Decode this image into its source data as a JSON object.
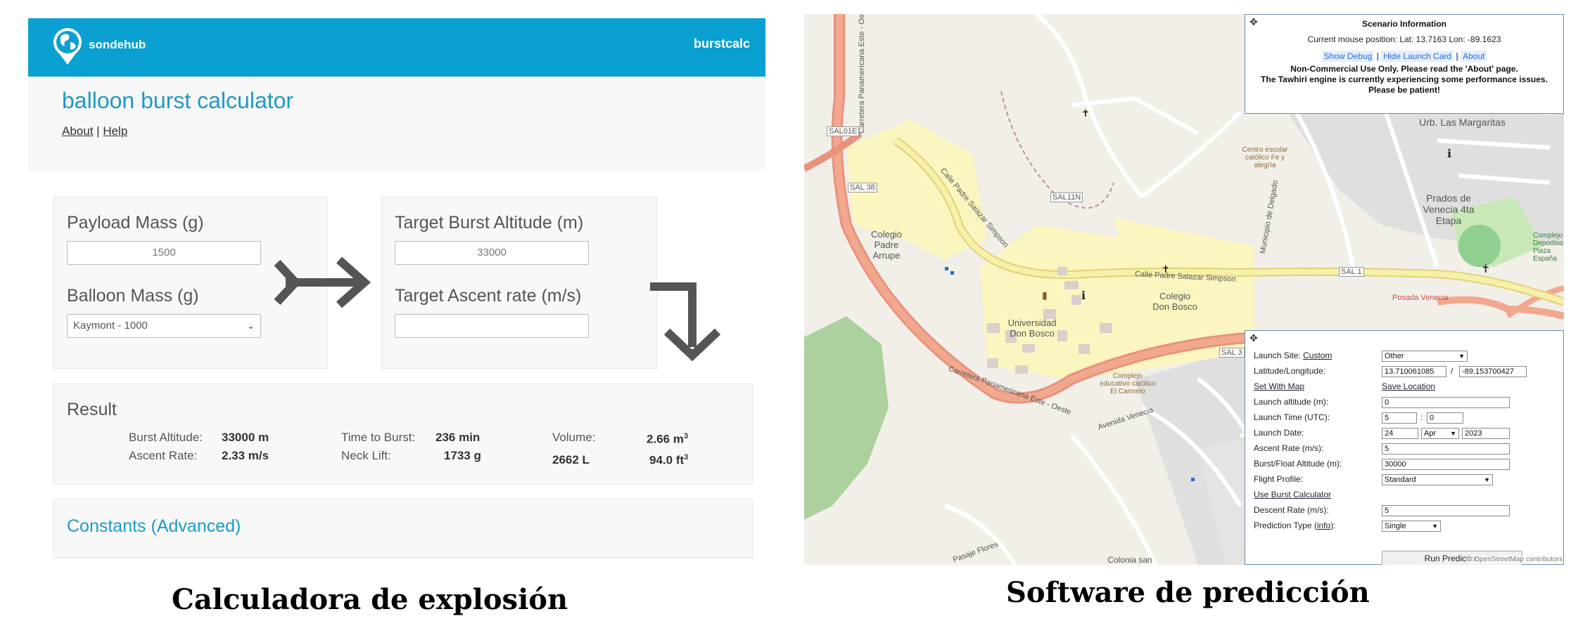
{
  "calculator": {
    "brand": "sondehub",
    "nav_right": "burstcalc",
    "title": "balloon burst calculator",
    "links": {
      "about": "About",
      "separator": "|",
      "help": "Help"
    },
    "payload": {
      "label": "Payload Mass (g)",
      "value": "1500"
    },
    "balloon": {
      "label": "Balloon Mass (g)",
      "selected": "Kaymont - 1000"
    },
    "target_burst": {
      "label": "Target Burst Altitude (m)",
      "value": "33000"
    },
    "target_ascent": {
      "label": "Target Ascent rate (m/s)",
      "value": ""
    },
    "result": {
      "heading": "Result",
      "burst_altitude_label": "Burst Altitude:",
      "burst_altitude": "33000 m",
      "ascent_rate_label": "Ascent Rate:",
      "ascent_rate": "2.33 m/s",
      "time_to_burst_label": "Time to Burst:",
      "time_to_burst": "236 min",
      "neck_lift_label": "Neck Lift:",
      "neck_lift": "1733 g",
      "volume_label": "Volume:",
      "volume_m3": "2.66 m",
      "volume_l": "2662 L",
      "volume_ft3": "94.0 ft",
      "cube_sup": "3"
    },
    "constants_link": "Constants (Advanced)",
    "caption": "Calculadora de explosión",
    "colors": {
      "header": "#0aa0d1",
      "title": "#1e9ac6"
    }
  },
  "predictor": {
    "scenario": {
      "title": "Scenario Information",
      "mouse_position": "Current mouse position: Lat: 13.7163 Lon: -89.1623",
      "show_debug": "Show Debug",
      "hide_launch_card": "Hide Launch Card",
      "about": "About",
      "sep": "|",
      "warning_1": "Non-Commercial Use Only. Please read the 'About' page.",
      "warning_2": "The Tawhiri engine is currently experiencing some performance issues. Please be patient!"
    },
    "form": {
      "launch_site_label": "Launch Site:",
      "launch_site_custom": "Custom",
      "launch_site_value": "Other",
      "latlon_label": "Latitude/Longitude:",
      "lat": "13.710061085",
      "slash": "/",
      "lon": "-89.153700427",
      "set_with_map": "Set With Map",
      "save_location": "Save Location",
      "altitude_label": "Launch altitude (m):",
      "altitude": "0",
      "time_label": "Launch Time (UTC):",
      "hour": "5",
      "colon": ":",
      "minute": "0",
      "date_label": "Launch Date:",
      "day": "24",
      "month": "Apr",
      "year": "2023",
      "ascent_label": "Ascent Rate (m/s):",
      "ascent": "5",
      "burst_label": "Burst/Float Altitude (m):",
      "burst": "30000",
      "profile_label": "Flight Profile:",
      "profile": "Standard",
      "use_burst_calc": "Use Burst Calculator",
      "descent_label": "Descent Rate (m/s):",
      "descent": "5",
      "prediction_type_label": "Prediction Type (",
      "prediction_type_info": "info",
      "prediction_type_close": "):",
      "prediction_type": "Single",
      "run": "Run Prediction"
    },
    "attribution": "© OpenStreetMap contributors",
    "map_labels": {
      "carretera_oeste": "Carretera Panamericana Este - Oeste",
      "carretera_este": "Carretera Panamericana Este - Oeste",
      "sal01e": "SAL01E",
      "sal38": "SAL 38",
      "sal11n": "SAL11N",
      "sal1": "SAL 1",
      "sal3": "SAL 3",
      "padre_salazar": "Calle Padre Salazar Simpson",
      "padre_salazar_2": "Calle Padre Salazar Simpson",
      "colegio_arrupe": "Colegio Padre Arrupe",
      "colegio_bosco": "Colegio Don Bosco",
      "universidad": "Universidad Don Bosco",
      "centro": "Centro escolar católico Fe y alegría",
      "complejo": "Complejo educativo católico El Carmelo",
      "prados": "Prados de Venecia 4ta Etapa",
      "urb": "Urb. Las Margaritas",
      "colonia": "Colonia san Isidro",
      "municipio": "Municipio de Delgado",
      "avenida_venecia": "Avenida Venecia",
      "pasaje_flores": "Pasaje Flores",
      "posada": "Posada Venecia",
      "complejo_dep": "Complejo Deportivo Plaza España"
    },
    "caption": "Software de predicción"
  }
}
